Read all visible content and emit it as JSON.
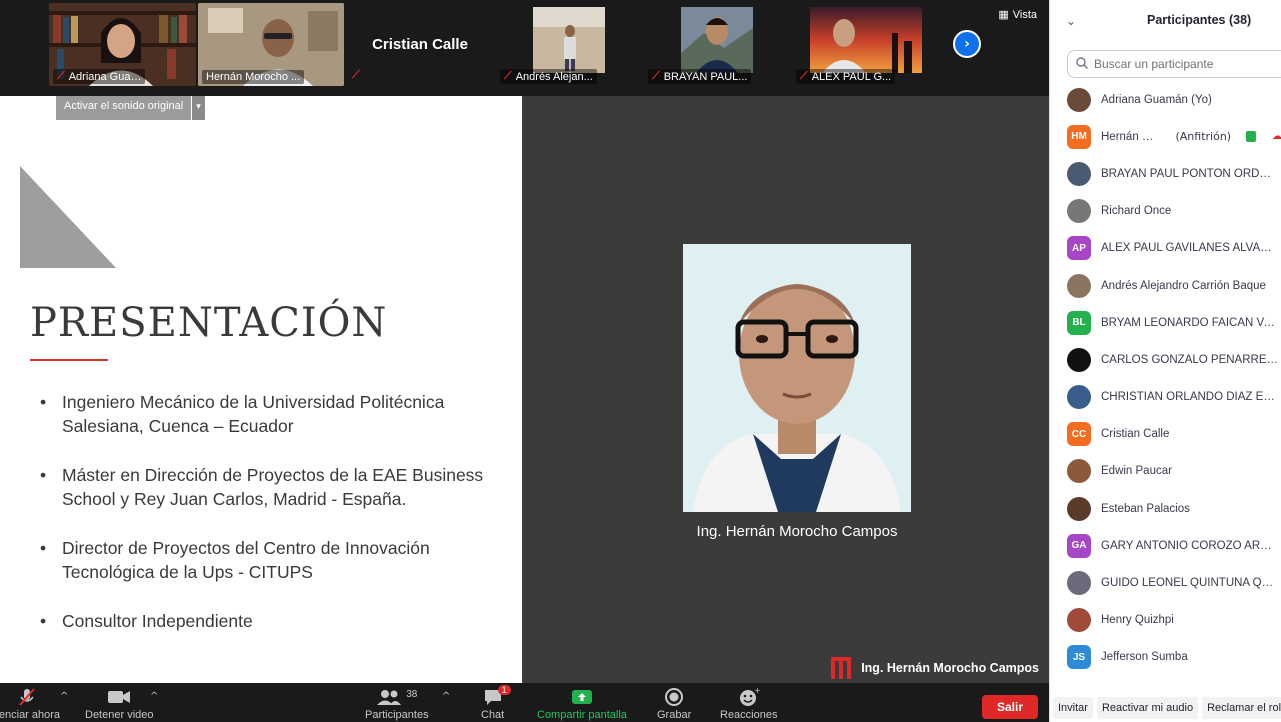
{
  "top_strip": {
    "thumbnails": [
      {
        "name": "Adriana Gua…"
      },
      {
        "name": "Hernán Morocho ..."
      },
      {
        "name": "Cristian Calle"
      },
      {
        "name": "Andrés Alejan..."
      },
      {
        "name": "BRAYAN PAUL..."
      },
      {
        "name": "ALEX PAUL G..."
      }
    ],
    "view_label": "Vista"
  },
  "slide": {
    "original_sound_button": "Activar el sonido original",
    "title": "PRESENTACIÓN",
    "bullets": [
      "Ingeniero Mecánico de la Universidad Politécnica Salesiana, Cuenca – Ecuador",
      "Máster en Dirección de Proyectos de la EAE Business School y Rey Juan Carlos, Madrid - España.",
      "Director de Proyectos del Centro de Innovación Tecnológica de la Ups - CITUPS",
      "Consultor Independiente"
    ]
  },
  "speaker": {
    "caption": "Ing. Hernán Morocho Campos",
    "brand_text": "Ing. Hernán Morocho Campos"
  },
  "toolbar": {
    "mute_label": "ilenciar ahora",
    "video_label": "Detener video",
    "participants_label": "Participantes",
    "participants_count": "38",
    "chat_label": "Chat",
    "chat_badge": "1",
    "share_label": "Compartir pantalla",
    "record_label": "Grabar",
    "reactions_label": "Reacciones",
    "leave_label": "Salir"
  },
  "panel": {
    "title": "Participantes (38)",
    "search_placeholder": "Buscar un participante",
    "host_tag": "(Anfitrión)",
    "participants": [
      {
        "name": "Adriana Guamán (Yo)",
        "initials": "",
        "color": "#6b4a3a"
      },
      {
        "name": "Hernán Moro...",
        "initials": "HM",
        "color": "#f26d21"
      },
      {
        "name": "BRAYAN PAUL PONTON ORDOÑ...",
        "initials": "",
        "color": "#4a5a70"
      },
      {
        "name": "Richard Once",
        "initials": "",
        "color": "#777777"
      },
      {
        "name": "ALEX PAUL GAVILANES ALVAREZ",
        "initials": "AP",
        "color": "#a746c9"
      },
      {
        "name": "Andrés Alejandro Carrión Baque",
        "initials": "",
        "color": "#8a7560"
      },
      {
        "name": "BRYAM LEONARDO FAICAN VAS...",
        "initials": "BL",
        "color": "#22b14c"
      },
      {
        "name": "CARLOS GONZALO PEÑARRETA ...",
        "initials": "",
        "color": "#111111"
      },
      {
        "name": "CHRISTIAN ORLANDO DIAZ ENRI...",
        "initials": "",
        "color": "#3a5e8c"
      },
      {
        "name": "Cristian Calle",
        "initials": "CC",
        "color": "#f26d21"
      },
      {
        "name": "Edwin Paucar",
        "initials": "",
        "color": "#8c5a3a"
      },
      {
        "name": "Esteban Palacios",
        "initials": "",
        "color": "#5c3a2a"
      },
      {
        "name": "GARY ANTONIO COROZO ARRO...",
        "initials": "GA",
        "color": "#a746c9"
      },
      {
        "name": "GUIDO LEONEL QUINTUÑA QUI...",
        "initials": "",
        "color": "#6a6a7a"
      },
      {
        "name": "Henry Quizhpi",
        "initials": "",
        "color": "#a04a3a"
      },
      {
        "name": "Jefferson Sumba",
        "initials": "JS",
        "color": "#2e8bd8"
      }
    ],
    "invite_label": "Invitar",
    "reenable_audio_label": "Reactivar mi audio",
    "reclaim_label": "Reclamar el rol"
  }
}
